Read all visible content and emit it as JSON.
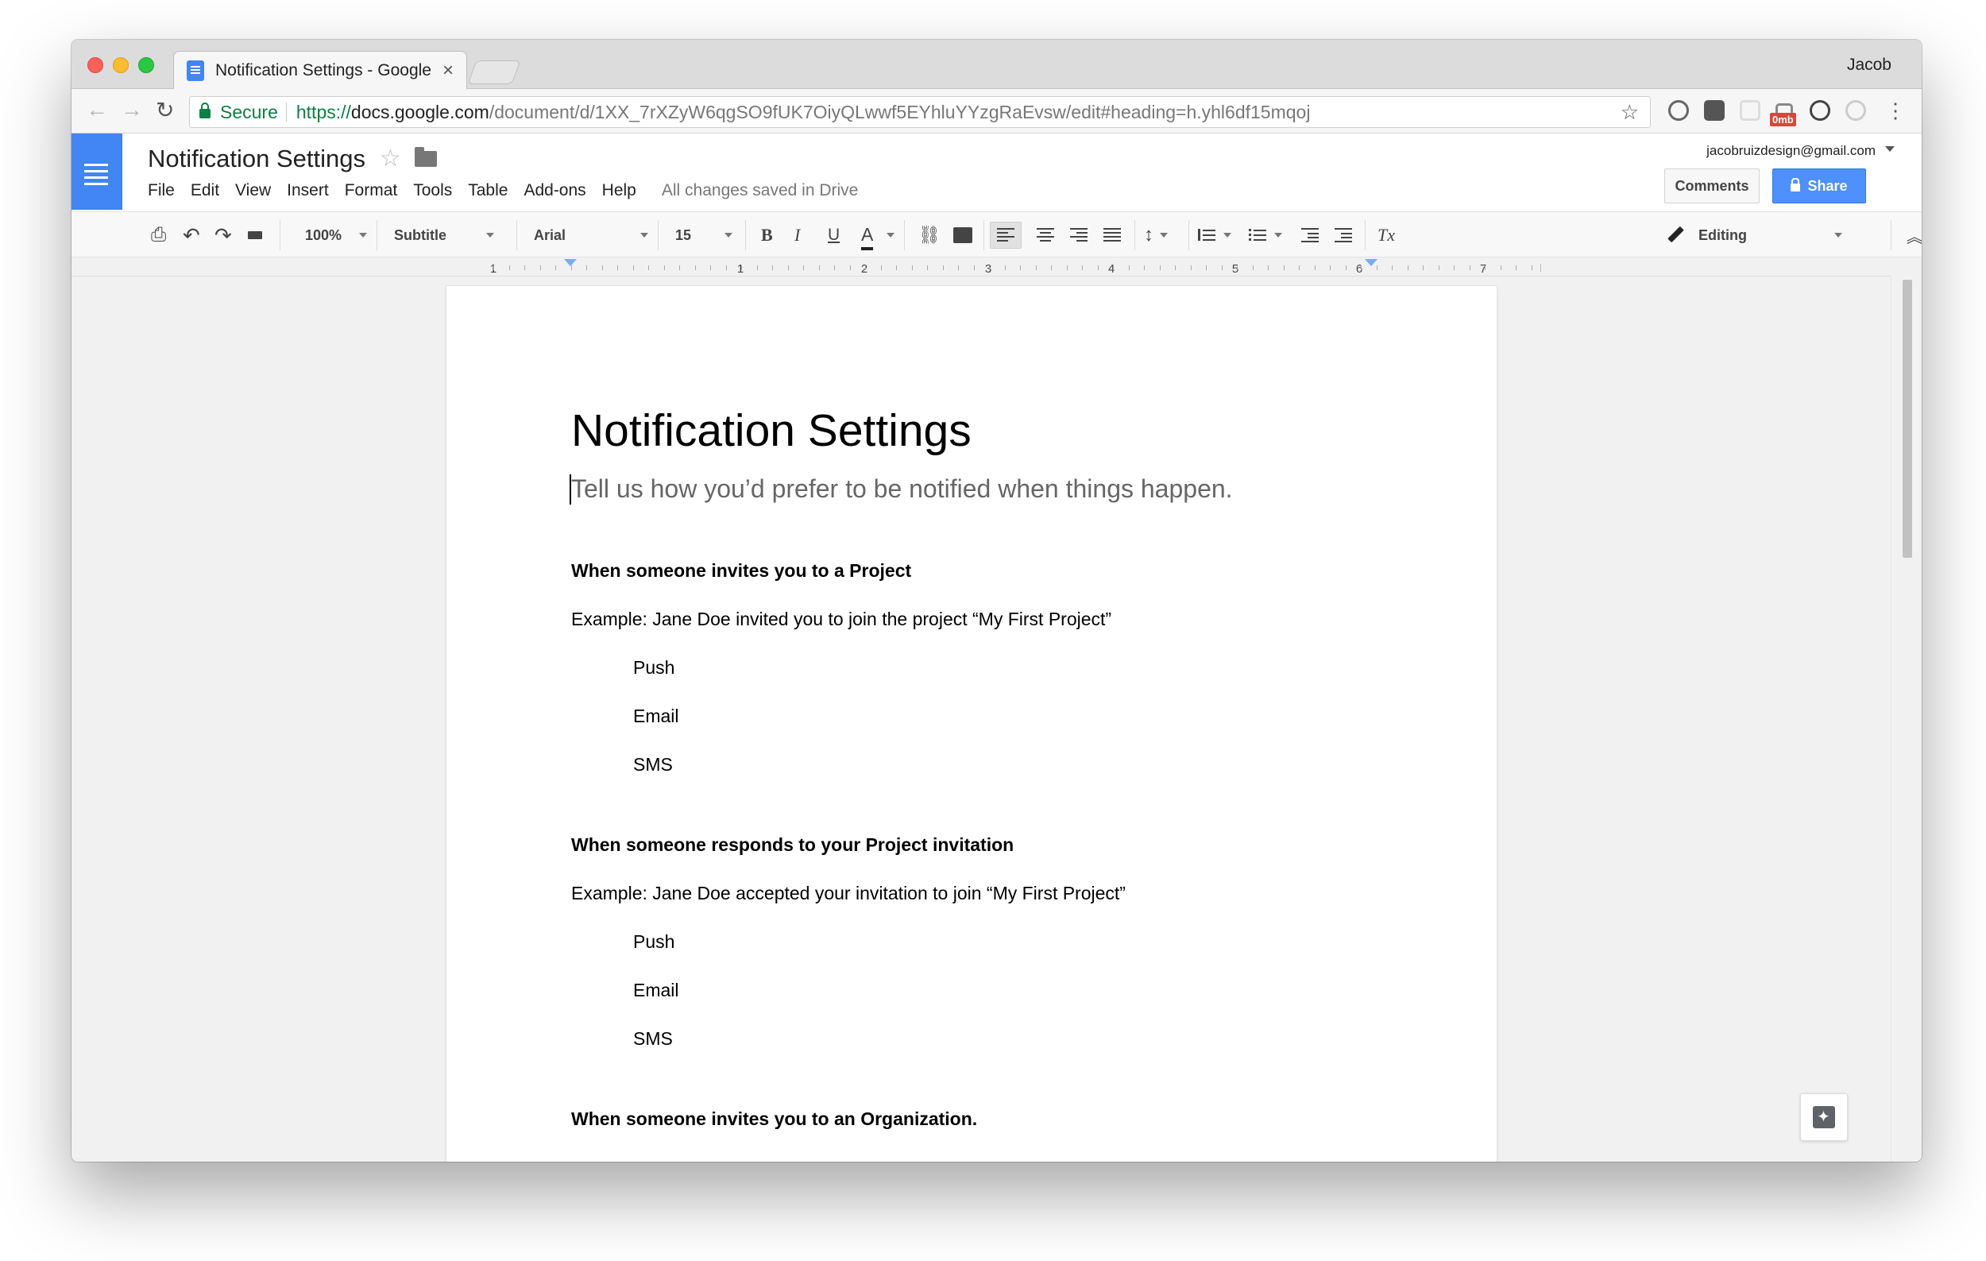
{
  "browser": {
    "tab_title": "Notification Settings - Google",
    "tab_close": "×",
    "profile_name": "Jacob",
    "secure_label": "Secure",
    "url_scheme": "https://",
    "url_host": "docs.google.com",
    "url_path": "/document/d/1XX_7rXZyW6qgSO9fUK7OiyQLwwf5EYhluYYzgRaEvsw/edit#heading=h.yhl6df15mqoj",
    "extension_badge": "0mb",
    "icons": {
      "back": "←",
      "forward": "→",
      "reload": "↻",
      "bookmark": "☆",
      "menu": "⋮"
    }
  },
  "docs": {
    "doc_title": "Notification Settings",
    "star": "☆",
    "menu": [
      "File",
      "Edit",
      "View",
      "Insert",
      "Format",
      "Tools",
      "Table",
      "Add-ons",
      "Help"
    ],
    "save_status": "All changes saved in Drive",
    "account_email": "jacobruizdesign@gmail.com",
    "comments_label": "Comments",
    "share_label": "Share"
  },
  "format_toolbar": {
    "zoom": "100%",
    "style": "Subtitle",
    "font": "Arial",
    "font_size": "15",
    "bold": "B",
    "italic": "I",
    "underline": "U",
    "text_color": "A",
    "clear_format": "Tx",
    "mode": "Editing",
    "collapse": "︽",
    "print": "⎙",
    "undo": "↶",
    "redo": "↷",
    "link": "⛓",
    "line_spacing": "↕"
  },
  "ruler": {
    "labels": [
      "1",
      "1",
      "2",
      "3",
      "4",
      "5",
      "6",
      "7"
    ]
  },
  "document": {
    "title": "Notification Settings",
    "subtitle": "Tell us how you’d prefer to be notified when things happen.",
    "sections": [
      {
        "heading": "When someone invites you to a Project",
        "example": "Example: Jane Doe invited you to join the project “My First Project”",
        "options": [
          "Push",
          "Email",
          "SMS"
        ]
      },
      {
        "heading": "When someone responds to your Project invitation",
        "example": "Example: Jane Doe accepted your invitation to join “My First Project”",
        "options": [
          "Push",
          "Email",
          "SMS"
        ]
      },
      {
        "heading": "When someone invites you to an Organization."
      }
    ]
  },
  "colors": {
    "docs_blue": "#4285f4",
    "share_blue": "#4d90fe",
    "secure_green": "#0b8043",
    "subtitle_gray": "#666666"
  }
}
